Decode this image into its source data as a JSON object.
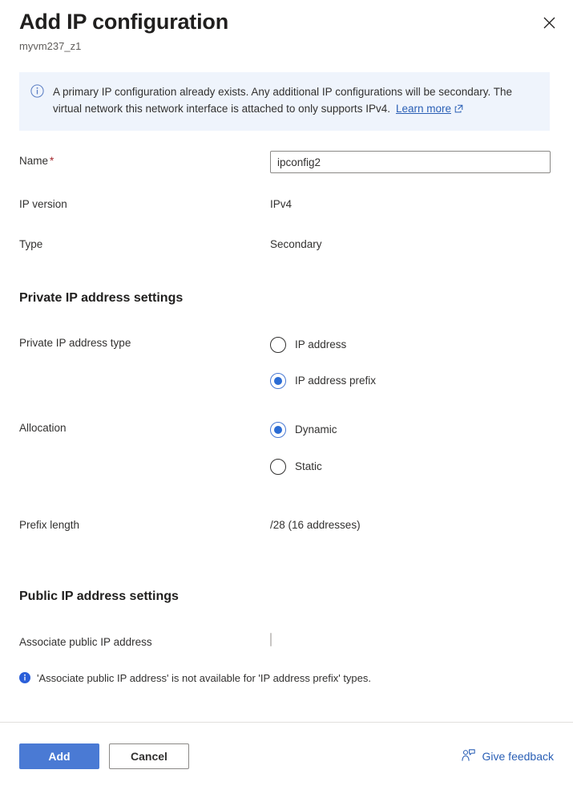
{
  "header": {
    "title": "Add IP configuration",
    "subtitle": "myvm237_z1",
    "close_icon": "close-icon"
  },
  "banner": {
    "icon": "info-circle-icon",
    "text": "A primary IP configuration already exists. Any additional IP configurations will be secondary. The virtual network this network interface is attached to only supports IPv4.",
    "link_label": "Learn more",
    "link_icon": "external-link-icon",
    "background": "#eff4fc"
  },
  "fields": {
    "name": {
      "label": "Name",
      "required_marker": "*",
      "value": "ipconfig2",
      "placeholder": ""
    },
    "ip_version": {
      "label": "IP version",
      "value": "IPv4"
    },
    "type": {
      "label": "Type",
      "value": "Secondary"
    }
  },
  "private_section": {
    "heading": "Private IP address settings",
    "address_type": {
      "label": "Private IP address type",
      "options": [
        {
          "label": "IP address",
          "checked": false
        },
        {
          "label": "IP address prefix",
          "checked": true
        }
      ]
    },
    "allocation": {
      "label": "Allocation",
      "options": [
        {
          "label": "Dynamic",
          "checked": true
        },
        {
          "label": "Static",
          "checked": false
        }
      ]
    },
    "prefix_length": {
      "label": "Prefix length",
      "value": "/28 (16 addresses)"
    }
  },
  "public_section": {
    "heading": "Public IP address settings",
    "associate": {
      "label": "Associate public IP address",
      "checked": false
    },
    "notice": {
      "icon": "info-filled-icon",
      "text": "'Associate public IP address' is not available for 'IP address prefix' types."
    }
  },
  "footer": {
    "add_label": "Add",
    "cancel_label": "Cancel",
    "feedback_label": "Give feedback",
    "feedback_icon": "feedback-person-icon",
    "accent": "#4a7ad4"
  }
}
